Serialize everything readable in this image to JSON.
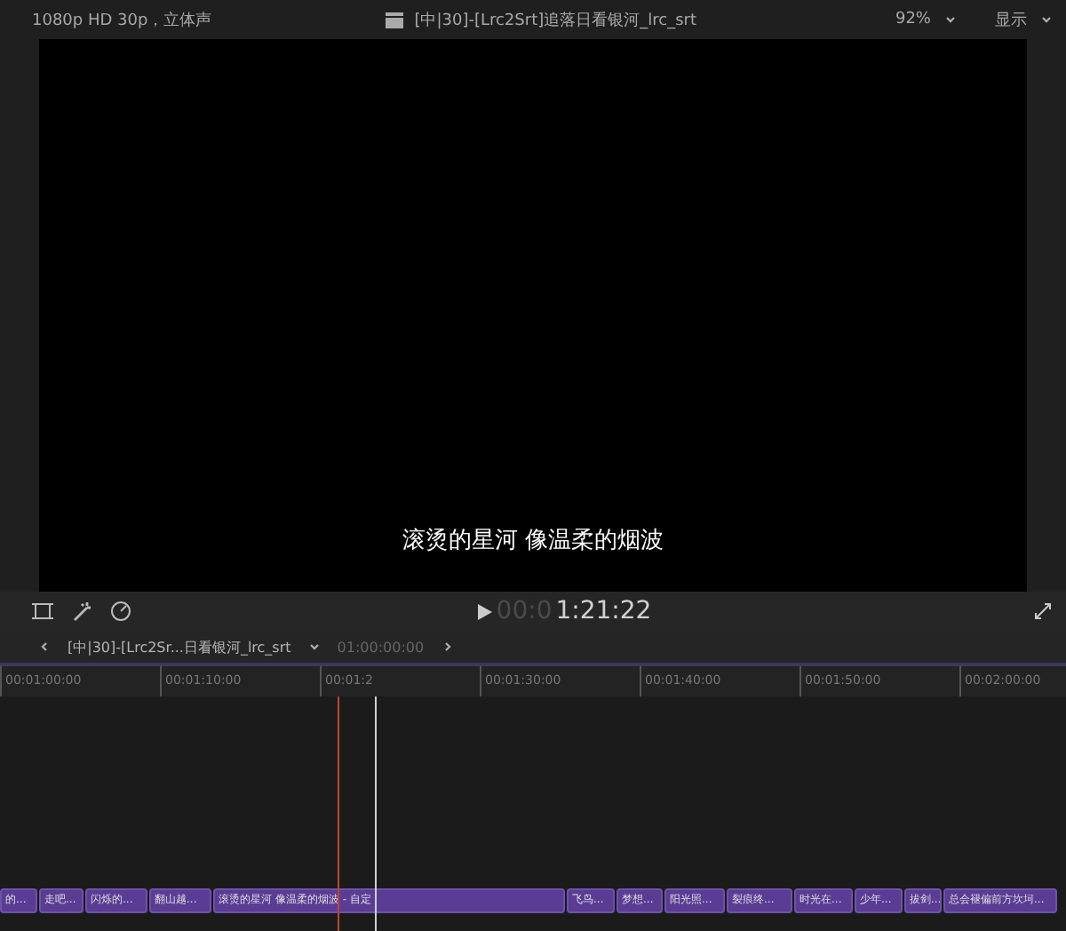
{
  "viewer_bar": {
    "format": "1080p HD 30p，立体声",
    "title": "[中|30]-[Lrc2Srt]追落日看银河_lrc_srt",
    "zoom": "92%",
    "view_menu": "显示"
  },
  "subtitle": "滚烫的星河 像温柔的烟波",
  "transport": {
    "timecode_dim": "00:0",
    "timecode": "1:21:22"
  },
  "timeline_header": {
    "project": "[中|30]-[Lrc2Sr...日看银河_lrc_srt",
    "start": "01:00:00:00"
  },
  "ruler": [
    "00:01:00:00",
    "00:01:10:00",
    "00:01:2",
    "00:01:30:00",
    "00:01:40:00",
    "00:01:50:00",
    "00:02:00:00"
  ],
  "clips": [
    {
      "label": "的..."
    },
    {
      "label": "走吧..."
    },
    {
      "label": "闪烁的..."
    },
    {
      "label": "翻山越..."
    },
    {
      "label": "滚烫的星河 像温柔的烟波 - 自定"
    },
    {
      "label": "飞鸟..."
    },
    {
      "label": "梦想..."
    },
    {
      "label": "阳光照..."
    },
    {
      "label": "裂痕终..."
    },
    {
      "label": "时光在..."
    },
    {
      "label": "少年..."
    },
    {
      "label": "拔剑..."
    },
    {
      "label": "总会褪偏前方坎坷..."
    }
  ]
}
